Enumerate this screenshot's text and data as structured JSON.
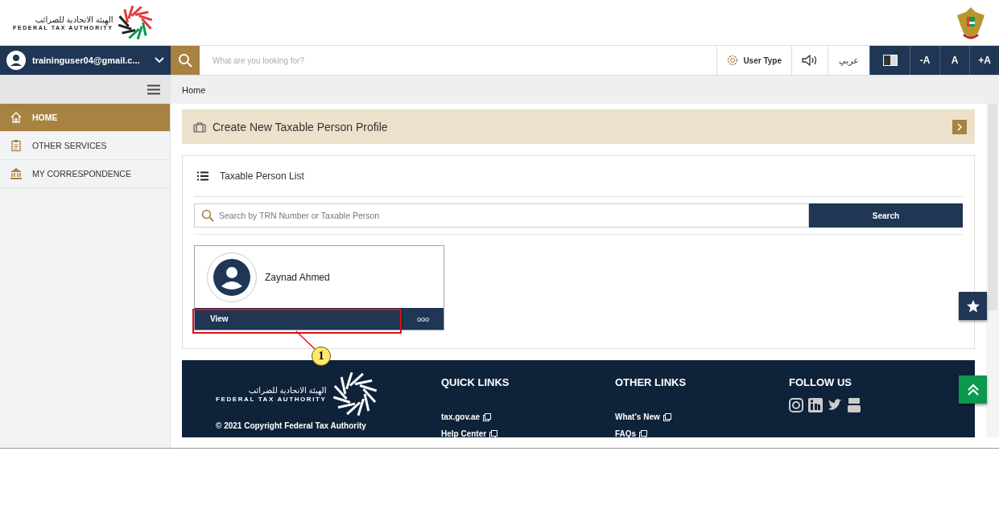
{
  "header": {
    "logo_arabic": "الهيئة الاتحادية للضرائب",
    "logo_english": "FEDERAL TAX AUTHORITY"
  },
  "nav": {
    "user": "traininguser04@gmail.c...",
    "search": {
      "placeholder": "What are you looking for?"
    },
    "user_type": "User Type",
    "language": "عربي",
    "font_buttons": [
      "-A",
      "A",
      "+A"
    ]
  },
  "sidebar": {
    "items": [
      {
        "label": "HOME",
        "kind": "home",
        "selected": true
      },
      {
        "label": "OTHER SERVICES",
        "kind": "clipboard",
        "selected": false
      },
      {
        "label": "MY CORRESPONDENCE",
        "kind": "bank",
        "selected": false
      }
    ]
  },
  "breadcrumb": "Home",
  "create_bar": {
    "title": "Create New Taxable Person Profile"
  },
  "list_panel": {
    "title": "Taxable Person List",
    "search": {
      "placeholder": "Search by TRN Number or Taxable Person",
      "button": "Search"
    },
    "persons": [
      {
        "name": "Zaynad Ahmed",
        "action": "View",
        "more": "ooo"
      }
    ]
  },
  "callout": {
    "number": "1"
  },
  "footer": {
    "logo_arabic": "الهيئة الاتحادية للضرائب",
    "logo_english": "FEDERAL TAX AUTHORITY",
    "copyright": "© 2021 Copyright Federal Tax Authority",
    "columns": [
      {
        "title": "QUICK LINKS",
        "kind": "links",
        "links": [
          "tax.gov.ae",
          "Help Center"
        ]
      },
      {
        "title": "OTHER LINKS",
        "kind": "links",
        "links": [
          "What's New",
          "FAQs"
        ]
      },
      {
        "title": "FOLLOW US",
        "kind": "social"
      }
    ]
  }
}
